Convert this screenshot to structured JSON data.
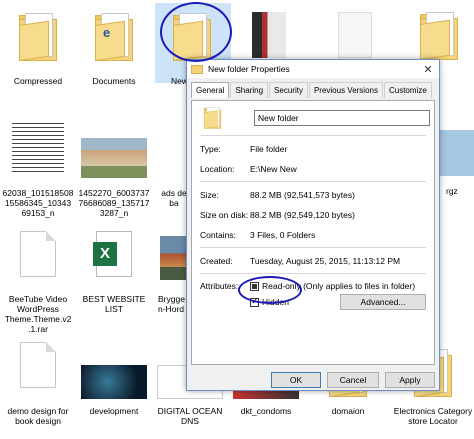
{
  "desktop": {
    "files": [
      {
        "label": "Compressed",
        "icon": "folder-icon"
      },
      {
        "label": "Documents",
        "icon": "folder-icon"
      },
      {
        "label": "New",
        "icon": "folder-icon"
      },
      {
        "label": "62038_101518508 15586345_10343 69153_n",
        "icon": "image-icon"
      },
      {
        "label": "1452270_6003737 76686089_135717 3287_n",
        "icon": "image-icon"
      },
      {
        "label": "ads de ba",
        "icon": "document-icon"
      },
      {
        "label": "BeeTube Video WordPress Theme.Theme.v2 .1.rar",
        "icon": "document-icon"
      },
      {
        "label": "BEST WEBSITE LIST",
        "icon": "excel-icon"
      },
      {
        "label": "Brygge n-Hord",
        "icon": "image-icon"
      },
      {
        "label": "demo design for book design",
        "icon": "document-icon"
      },
      {
        "label": "development",
        "icon": "image-icon"
      },
      {
        "label": "DIGITAL OCEAN DNS",
        "icon": "image-icon"
      },
      {
        "label": "dkt_condoms",
        "icon": "image-icon"
      },
      {
        "label": "domaion",
        "icon": "folder-icon"
      },
      {
        "label": "Electronics Category store Locator",
        "icon": "folder-icon"
      },
      {
        "label": "rgz",
        "icon": "image-icon"
      }
    ]
  },
  "dialog": {
    "title": "New folder Properties",
    "close": "✕",
    "tabs": [
      "General",
      "Sharing",
      "Security",
      "Previous Versions",
      "Customize"
    ],
    "name_value": "New folder",
    "type_label": "Type:",
    "type_value": "File folder",
    "location_label": "Location:",
    "location_value": "E:\\New New",
    "size_label": "Size:",
    "size_value": "88.2 MB (92,541,573 bytes)",
    "sizeondisk_label": "Size on disk:",
    "sizeondisk_value": "88.2 MB (92,549,120 bytes)",
    "contains_label": "Contains:",
    "contains_value": "3 Files, 0 Folders",
    "created_label": "Created:",
    "created_value": "Tuesday, August 25, 2015, 11:13:12 PM",
    "attributes_label": "Attributes:",
    "readonly_label": "Read-only (Only applies to files in folder)",
    "hidden_label": "Hidden",
    "advanced_button": "Advanced...",
    "ok_button": "OK",
    "cancel_button": "Cancel",
    "apply_button": "Apply"
  },
  "colors": {
    "annotation": "#1a1ab8",
    "folder": "#f5d27a",
    "dialog_border": "#6b8fc4"
  }
}
